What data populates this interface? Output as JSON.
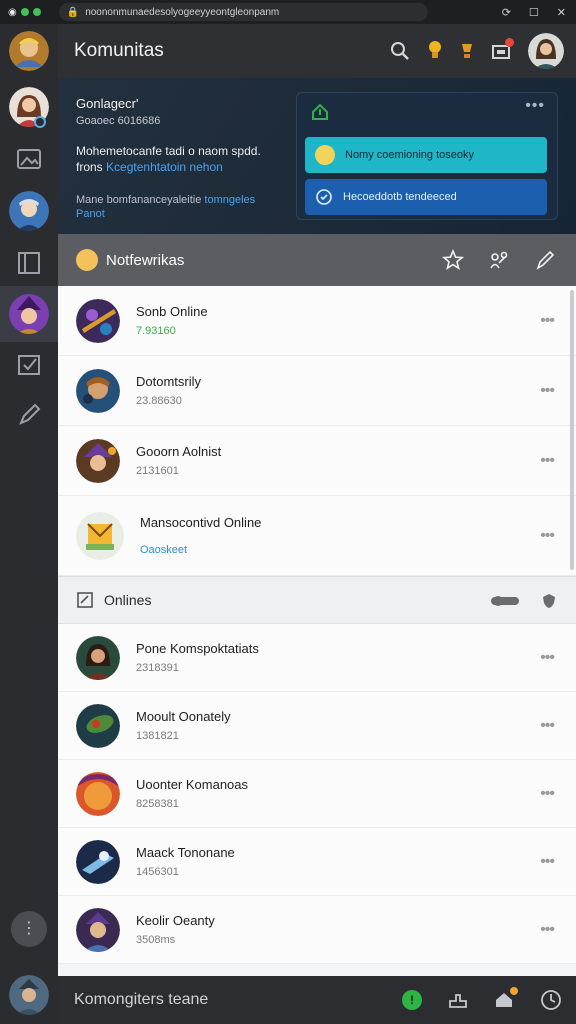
{
  "browser": {
    "url": "noononmunaedesolyogeeyyeontgleonpanm"
  },
  "header": {
    "title": "Komunitas"
  },
  "hero": {
    "title": "Gonlagecr'",
    "subtitle": "Goaoec 6016686",
    "body_text": "Mohemetocanfe tadi o naom spdd.",
    "body_text2": "frons",
    "body_highlight": "Kcegtenhtatoin nehon",
    "foot_text": "Mane bomfananceyaleitie",
    "foot_highlight": "tomngeles",
    "foot_highlight2": "Panot",
    "panel_button_1": "Nomy coemioning toseoky",
    "panel_button_2": "Hecoeddotb tendeeced"
  },
  "section_notifications": {
    "title": "Notfewrikas"
  },
  "section_onlines": {
    "title": "Onlines"
  },
  "rows_top": [
    {
      "name": "Sonb Online",
      "sub": "7.93160"
    },
    {
      "name": "Dotomtsrily",
      "sub": "23.88630"
    },
    {
      "name": "Gooorn Aolnist",
      "sub": "2131601"
    },
    {
      "name": "Mansocontivd Online",
      "sub": "Oaoskeet"
    }
  ],
  "rows_bottom": [
    {
      "name": "Pone Komspoktatiats",
      "sub": "2318391"
    },
    {
      "name": "Mooult Oonately",
      "sub": "1381821"
    },
    {
      "name": "Uoonter Komanoas",
      "sub": "8258381"
    },
    {
      "name": "Maack Tononane",
      "sub": "1456301"
    },
    {
      "name": "Keolir Oeanty",
      "sub": "3508ms"
    }
  ],
  "bottombar": {
    "title": "Komongiters  teane"
  },
  "colors": {
    "accent_blue": "#4aa3f0",
    "online_green": "#2fb344",
    "panel_teal": "#1fb6c8",
    "panel_blue": "#1c5fae"
  },
  "icons": {
    "search": "search-icon",
    "bulb": "lightbulb-icon",
    "star": "star-icon",
    "settings": "settings-icon",
    "pencil": "pencil-icon"
  }
}
